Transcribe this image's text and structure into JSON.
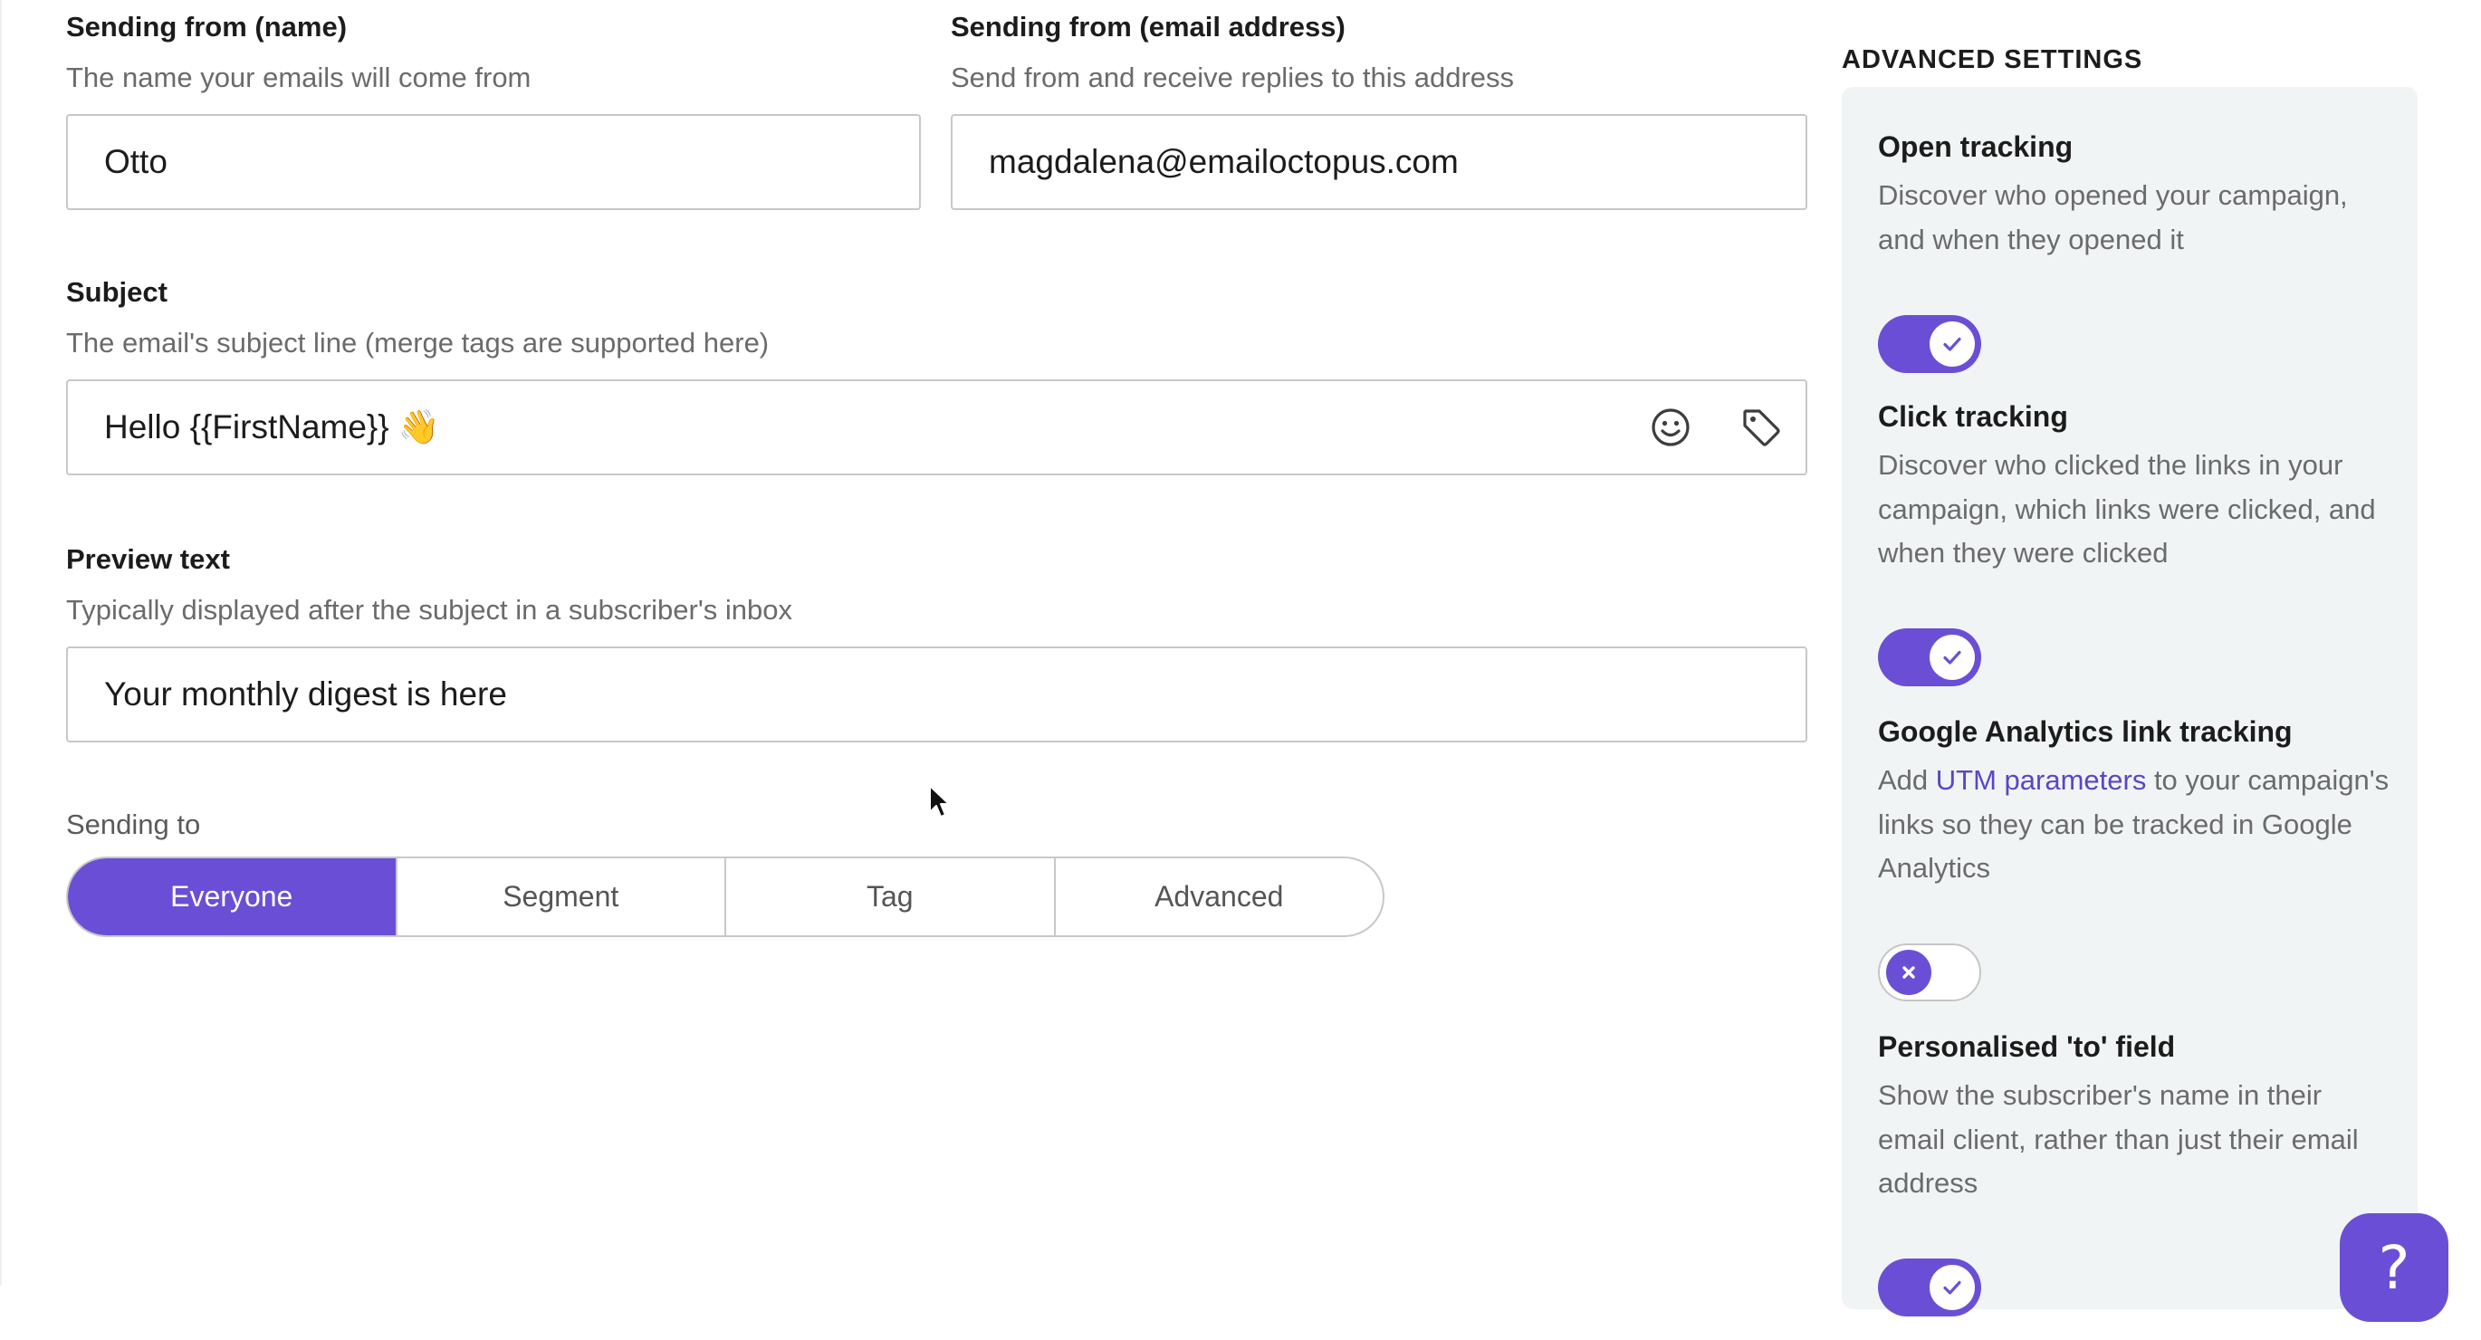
{
  "form": {
    "from_name": {
      "label": "Sending from (name)",
      "help": "The name your emails will come from",
      "value": "Otto"
    },
    "from_email": {
      "label": "Sending from (email address)",
      "help": "Send from and receive replies to this address",
      "value": "magdalena@emailoctopus.com"
    },
    "subject": {
      "label": "Subject",
      "help": "The email's subject line (merge tags are supported here)",
      "value": "Hello {{FirstName}} 👋",
      "emoji_icon": "smiley-icon",
      "tag_icon": "tag-icon"
    },
    "preview_text": {
      "label": "Preview text",
      "help": "Typically displayed after the subject in a subscriber's inbox",
      "value": "Your monthly digest is here"
    },
    "sending_to": {
      "label": "Sending to",
      "options": [
        "Everyone",
        "Segment",
        "Tag",
        "Advanced"
      ],
      "selected": "Everyone"
    }
  },
  "advanced": {
    "heading": "ADVANCED SETTINGS",
    "settings": [
      {
        "title": "Open tracking",
        "description": "Discover who opened your campaign, and when they opened it",
        "enabled": true
      },
      {
        "title": "Click tracking",
        "description": "Discover who clicked the links in your campaign, which links were clicked, and when they were clicked",
        "enabled": true
      },
      {
        "title": "Google Analytics link tracking",
        "description_prefix": "Add ",
        "description_link": "UTM parameters",
        "description_suffix": " to your campaign's links so they can be tracked in Google Analytics",
        "enabled": false
      },
      {
        "title": "Personalised 'to' field",
        "description": "Show the subscriber's name in their email client, rather than just their email address",
        "enabled": true
      }
    ]
  },
  "help_button": {
    "label": "?"
  },
  "colors": {
    "accent": "#6a4fd6",
    "link": "#5b45c7",
    "panel_bg": "#f1f4f5"
  }
}
